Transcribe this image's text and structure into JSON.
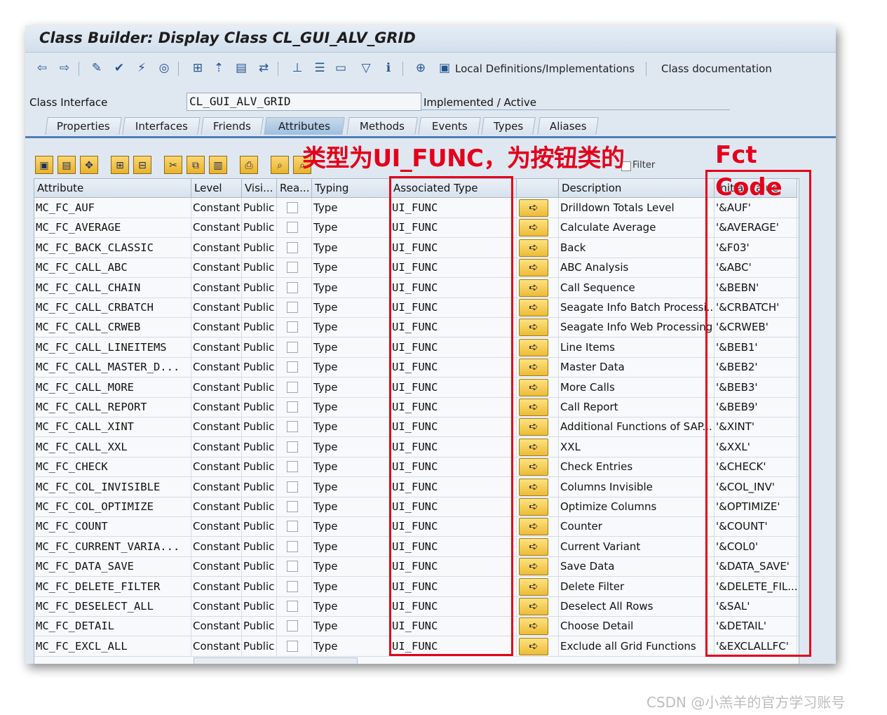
{
  "window": {
    "title": "Class Builder: Display Class CL_GUI_ALV_GRID"
  },
  "toolbar": {
    "local_defs_label": "Local Definitions/Implementations",
    "class_doc_label": "Class documentation"
  },
  "class_interface": {
    "label": "Class Interface",
    "value": "CL_GUI_ALV_GRID",
    "status": "Implemented / Active"
  },
  "tabs": [
    "Properties",
    "Interfaces",
    "Friends",
    "Attributes",
    "Methods",
    "Events",
    "Types",
    "Aliases"
  ],
  "active_tab": "Attributes",
  "grid_toolbar": {
    "filter_label": "Filter"
  },
  "columns": {
    "attribute": "Attribute",
    "level": "Level",
    "visibility": "Visi...",
    "read_only": "Rea...",
    "typing": "Typing",
    "associated_type": "Associated Type",
    "description": "Description",
    "initial_value": "Initial value"
  },
  "rows": [
    {
      "attr": "MC_FC_AUF",
      "level": "Constant",
      "vis": "Public",
      "typing": "Type",
      "type": "UI_FUNC",
      "desc": "Drilldown Totals Level",
      "init": "'&AUF'"
    },
    {
      "attr": "MC_FC_AVERAGE",
      "level": "Constant",
      "vis": "Public",
      "typing": "Type",
      "type": "UI_FUNC",
      "desc": "Calculate Average",
      "init": "'&AVERAGE'"
    },
    {
      "attr": "MC_FC_BACK_CLASSIC",
      "level": "Constant",
      "vis": "Public",
      "typing": "Type",
      "type": "UI_FUNC",
      "desc": "Back",
      "init": "'&F03'"
    },
    {
      "attr": "MC_FC_CALL_ABC",
      "level": "Constant",
      "vis": "Public",
      "typing": "Type",
      "type": "UI_FUNC",
      "desc": "ABC Analysis",
      "init": "'&ABC'"
    },
    {
      "attr": "MC_FC_CALL_CHAIN",
      "level": "Constant",
      "vis": "Public",
      "typing": "Type",
      "type": "UI_FUNC",
      "desc": "Call Sequence",
      "init": "'&BEBN'"
    },
    {
      "attr": "MC_FC_CALL_CRBATCH",
      "level": "Constant",
      "vis": "Public",
      "typing": "Type",
      "type": "UI_FUNC",
      "desc": "Seagate Info Batch Processi...",
      "init": "'&CRBATCH'"
    },
    {
      "attr": "MC_FC_CALL_CRWEB",
      "level": "Constant",
      "vis": "Public",
      "typing": "Type",
      "type": "UI_FUNC",
      "desc": "Seagate Info Web Processing",
      "init": "'&CRWEB'"
    },
    {
      "attr": "MC_FC_CALL_LINEITEMS",
      "level": "Constant",
      "vis": "Public",
      "typing": "Type",
      "type": "UI_FUNC",
      "desc": "Line Items",
      "init": "'&BEB1'"
    },
    {
      "attr": "MC_FC_CALL_MASTER_D...",
      "level": "Constant",
      "vis": "Public",
      "typing": "Type",
      "type": "UI_FUNC",
      "desc": "Master Data",
      "init": "'&BEB2'"
    },
    {
      "attr": "MC_FC_CALL_MORE",
      "level": "Constant",
      "vis": "Public",
      "typing": "Type",
      "type": "UI_FUNC",
      "desc": "More Calls",
      "init": "'&BEB3'"
    },
    {
      "attr": "MC_FC_CALL_REPORT",
      "level": "Constant",
      "vis": "Public",
      "typing": "Type",
      "type": "UI_FUNC",
      "desc": "Call Report",
      "init": "'&BEB9'"
    },
    {
      "attr": "MC_FC_CALL_XINT",
      "level": "Constant",
      "vis": "Public",
      "typing": "Type",
      "type": "UI_FUNC",
      "desc": "Additional Functions of SAP...",
      "init": "'&XINT'"
    },
    {
      "attr": "MC_FC_CALL_XXL",
      "level": "Constant",
      "vis": "Public",
      "typing": "Type",
      "type": "UI_FUNC",
      "desc": "XXL",
      "init": "'&XXL'"
    },
    {
      "attr": "MC_FC_CHECK",
      "level": "Constant",
      "vis": "Public",
      "typing": "Type",
      "type": "UI_FUNC",
      "desc": "Check Entries",
      "init": "'&CHECK'"
    },
    {
      "attr": "MC_FC_COL_INVISIBLE",
      "level": "Constant",
      "vis": "Public",
      "typing": "Type",
      "type": "UI_FUNC",
      "desc": "Columns Invisible",
      "init": "'&COL_INV'"
    },
    {
      "attr": "MC_FC_COL_OPTIMIZE",
      "level": "Constant",
      "vis": "Public",
      "typing": "Type",
      "type": "UI_FUNC",
      "desc": "Optimize Columns",
      "init": "'&OPTIMIZE'"
    },
    {
      "attr": "MC_FC_COUNT",
      "level": "Constant",
      "vis": "Public",
      "typing": "Type",
      "type": "UI_FUNC",
      "desc": "Counter",
      "init": "'&COUNT'"
    },
    {
      "attr": "MC_FC_CURRENT_VARIA...",
      "level": "Constant",
      "vis": "Public",
      "typing": "Type",
      "type": "UI_FUNC",
      "desc": "Current Variant",
      "init": "'&COL0'"
    },
    {
      "attr": "MC_FC_DATA_SAVE",
      "level": "Constant",
      "vis": "Public",
      "typing": "Type",
      "type": "UI_FUNC",
      "desc": "Save Data",
      "init": "'&DATA_SAVE'"
    },
    {
      "attr": "MC_FC_DELETE_FILTER",
      "level": "Constant",
      "vis": "Public",
      "typing": "Type",
      "type": "UI_FUNC",
      "desc": "Delete Filter",
      "init": "'&DELETE_FIL..."
    },
    {
      "attr": "MC_FC_DESELECT_ALL",
      "level": "Constant",
      "vis": "Public",
      "typing": "Type",
      "type": "UI_FUNC",
      "desc": "Deselect All Rows",
      "init": "'&SAL'"
    },
    {
      "attr": "MC_FC_DETAIL",
      "level": "Constant",
      "vis": "Public",
      "typing": "Type",
      "type": "UI_FUNC",
      "desc": "Choose Detail",
      "init": "'&DETAIL'"
    },
    {
      "attr": "MC_FC_EXCL_ALL",
      "level": "Constant",
      "vis": "Public",
      "typing": "Type",
      "type": "UI_FUNC",
      "desc": "Exclude all Grid Functions",
      "init": "'&EXCLALLFC'"
    }
  ],
  "annotations": {
    "type_note": "类型为UI_FUNC，为按钮类的",
    "fct_code_line1": "Fct",
    "fct_code_line2": "Code"
  },
  "watermark": "CSDN @小羔羊的官方学习账号",
  "colors": {
    "annotation_red": "#e3001b",
    "button_yellow": "#f3c84a",
    "active_tab": "#9ebfe0"
  }
}
